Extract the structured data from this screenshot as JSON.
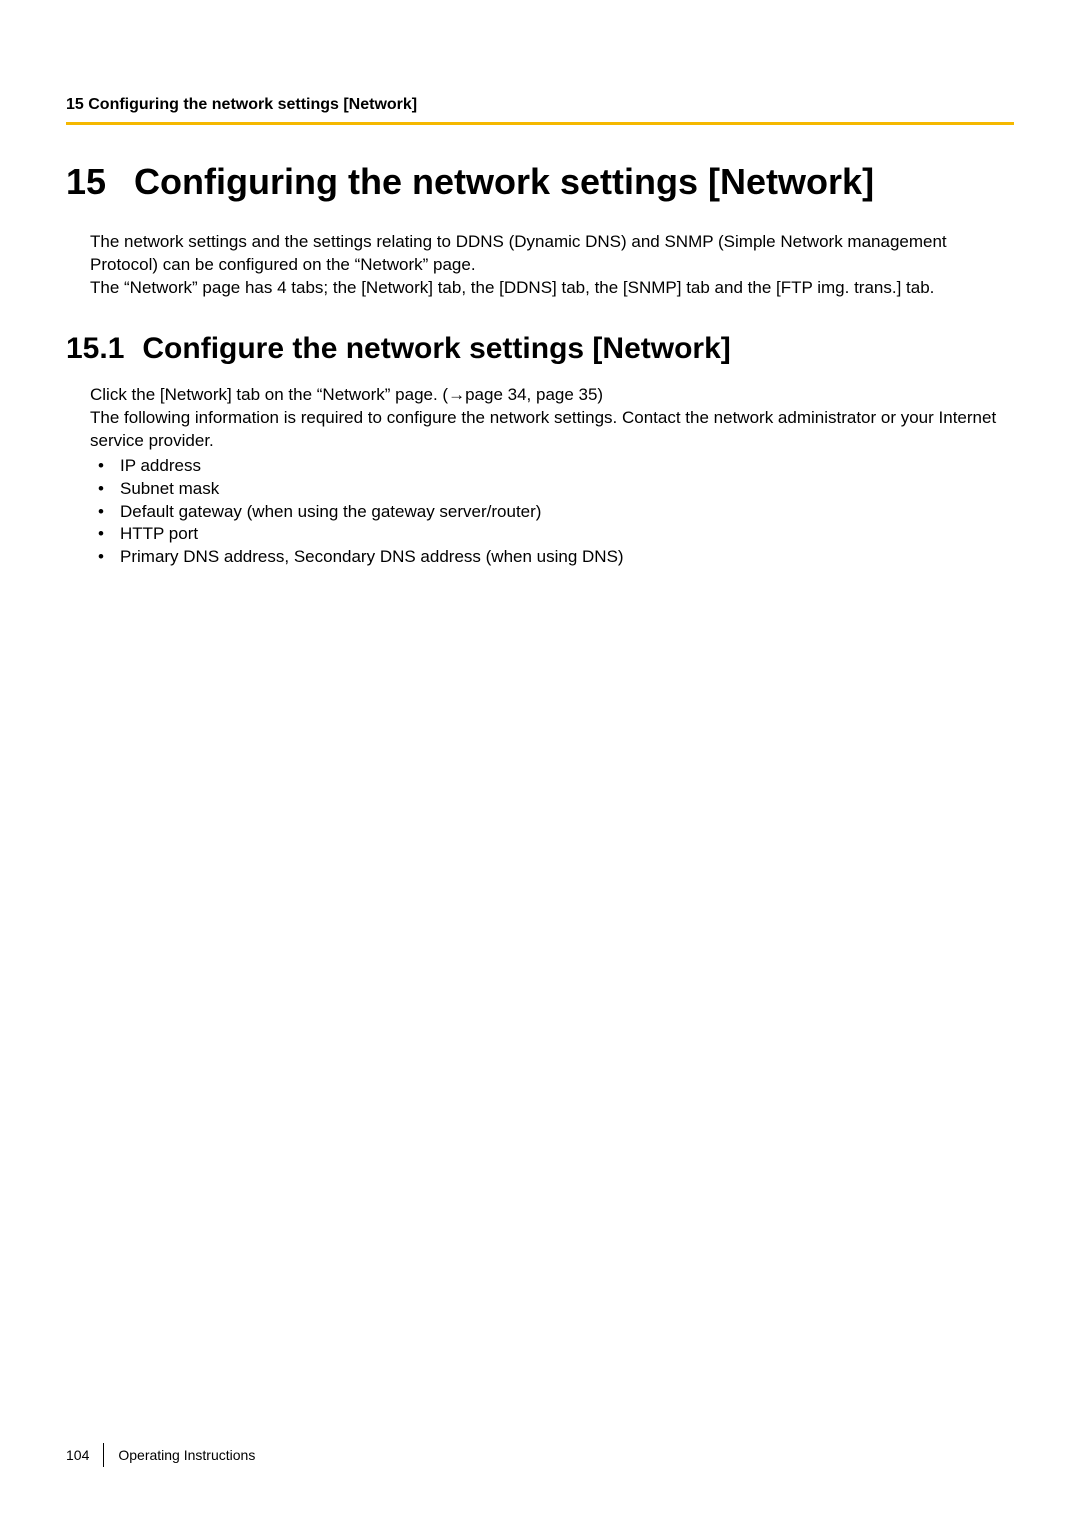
{
  "header": {
    "running_head": "15 Configuring the network settings [Network]"
  },
  "chapter": {
    "number": "15",
    "title": "Configuring the network settings [Network]",
    "intro_para_1": "The network settings and the settings relating to DDNS (Dynamic DNS) and SNMP (Simple Network management Protocol) can be configured on the “Network” page.",
    "intro_para_2": "The “Network” page has 4 tabs; the [Network] tab, the [DDNS] tab, the [SNMP] tab and the [FTP img. trans.] tab."
  },
  "section": {
    "number": "15.1",
    "title": "Configure the network settings [Network]",
    "para_1": "Click the [Network] tab on the “Network” page. (→page 34, page 35)",
    "para_2": "The following information is required to configure the network settings. Contact the network administrator or your Internet service provider.",
    "bullets": [
      "IP address",
      "Subnet mask",
      "Default gateway (when using the gateway server/router)",
      "HTTP port",
      "Primary DNS address, Secondary DNS address (when using DNS)"
    ]
  },
  "footer": {
    "page_number": "104",
    "doc_title": "Operating Instructions"
  }
}
